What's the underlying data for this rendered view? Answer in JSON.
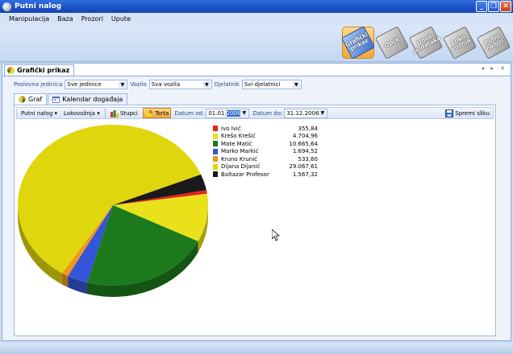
{
  "window": {
    "title": "Putni nalog"
  },
  "menu": [
    "Manipulacija",
    "Baza",
    "Prozori",
    "Upute"
  ],
  "ribbon": [
    {
      "label": "Grafički prikaz",
      "active": true
    },
    {
      "label": "Opće",
      "active": false
    },
    {
      "label": "Unos podataka",
      "active": false
    },
    {
      "label": "Loko vožnja",
      "active": false
    },
    {
      "label": "Putni nalozi",
      "active": false
    }
  ],
  "doc_tab": "Grafički prikaz",
  "filters": {
    "poslovna_label": "Poslovna jedinica",
    "poslovna_value": "Sve jedinice",
    "vozilo_label": "Vozilo",
    "vozilo_value": "Sva vozila",
    "djelatnik_label": "Djelatnik",
    "djelatnik_value": "Svi djelatnici"
  },
  "tabs": [
    "Graf",
    "Kalendar događaja"
  ],
  "toolbar": {
    "putni_nalog": "Putni nalog",
    "lokovoznja": "Lokovožnja",
    "stupci": "Stupci",
    "torta": "Torta",
    "datum_od_label": "Datum od:",
    "datum_od_prefix": "01.01.",
    "datum_od_sel": "2006",
    "datum_do_label": "Datum do:",
    "datum_do": "31.12.2006",
    "spremi": "Spremi sliku"
  },
  "chart_data": {
    "type": "pie",
    "categories": [
      "Ivo Ivić",
      "Krešo Krešić",
      "Mate Matić",
      "Marko Markić",
      "Kruno Krunić",
      "Dijana Dijanić",
      "Baltazar Profesor"
    ],
    "labels": [
      "355,84",
      "4.704,96",
      "10.665,64",
      "1.694,52",
      "533,60",
      "29.067,61",
      "1.567,32"
    ],
    "values": [
      355.84,
      4704.96,
      10665.64,
      1694.52,
      533.6,
      29067.61,
      1567.32
    ],
    "colors": [
      "#e8231c",
      "#e9e21a",
      "#1c7a1c",
      "#3556d8",
      "#f0961c",
      "#e0d60e",
      "#1a1a1a"
    ],
    "legend": "top-right"
  }
}
